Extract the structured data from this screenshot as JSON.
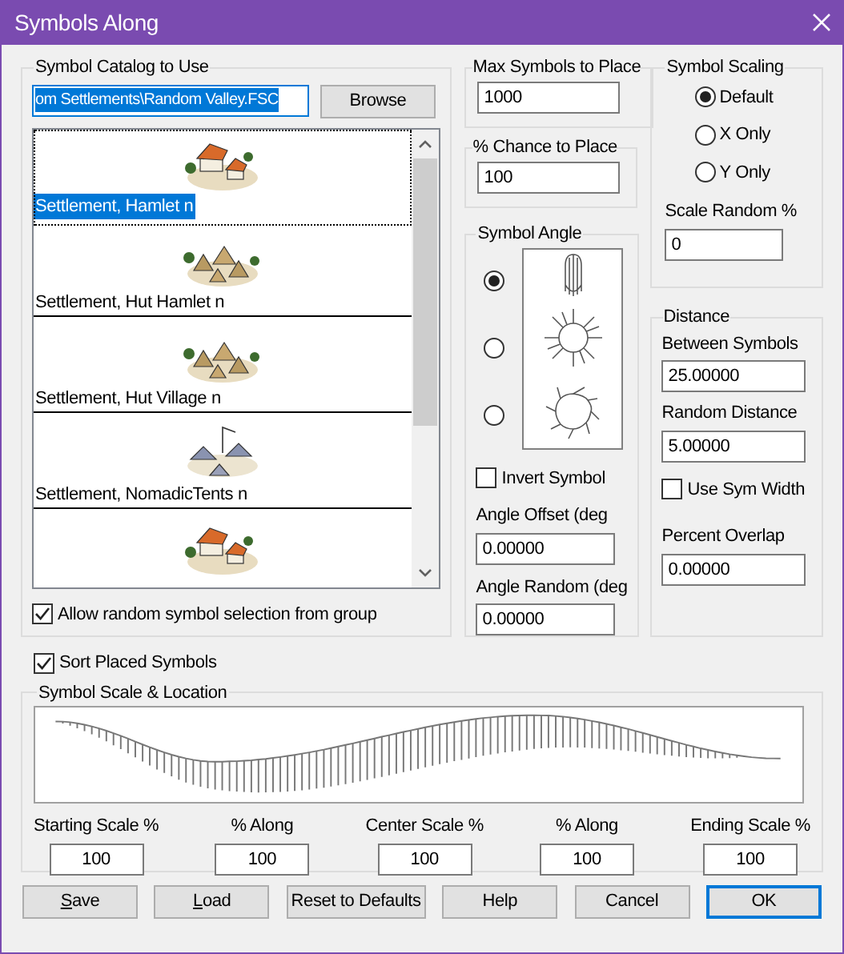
{
  "window": {
    "title": "Symbols Along"
  },
  "catalog": {
    "legend": "Symbol Catalog to Use",
    "path": "om Settlements\\Random Valley.FSC",
    "browse": "Browse",
    "items": [
      {
        "kind": "hamlet",
        "label": "Settlement, Hamlet n",
        "selected": true
      },
      {
        "kind": "huts",
        "label": "Settlement, Hut Hamlet n",
        "selected": false
      },
      {
        "kind": "huts",
        "label": "Settlement, Hut Village n",
        "selected": false
      },
      {
        "kind": "tents",
        "label": "Settlement, NomadicTents n",
        "selected": false
      },
      {
        "kind": "hamlet",
        "selected": false
      }
    ],
    "allow_random": {
      "label": "Allow random symbol selection from group",
      "checked": true
    }
  },
  "max_symbols": {
    "legend": "Max Symbols to Place",
    "value": "1000"
  },
  "chance": {
    "legend": "% Chance to Place",
    "value": "100"
  },
  "symbol_angle": {
    "legend": "Symbol Angle",
    "options": [
      {
        "kind": "aligned",
        "selected": true
      },
      {
        "kind": "radial",
        "selected": false
      },
      {
        "kind": "spiral",
        "selected": false
      }
    ],
    "invert": {
      "label": "Invert Symbol",
      "checked": false
    },
    "angle_offset": {
      "label": "Angle Offset (deg",
      "value": "0.00000"
    },
    "angle_random": {
      "label": "Angle Random (deg",
      "value": "0.00000"
    }
  },
  "symbol_scaling": {
    "legend": "Symbol Scaling",
    "options": [
      {
        "label": "Default",
        "selected": true
      },
      {
        "label": "X Only",
        "selected": false
      },
      {
        "label": "Y Only",
        "selected": false
      }
    ],
    "scale_random": {
      "label": "Scale Random %",
      "value": "0"
    }
  },
  "distance": {
    "legend": "Distance",
    "between": {
      "label": "Between Symbols",
      "value": "25.00000"
    },
    "random": {
      "label": "Random Distance",
      "value": "5.00000"
    },
    "use_sym_width": {
      "label": "Use Sym Width",
      "checked": false
    },
    "overlap": {
      "label": "Percent Overlap",
      "value": "0.00000"
    }
  },
  "sort_placed": {
    "label": "Sort Placed Symbols",
    "checked": true
  },
  "scale_location": {
    "legend": "Symbol Scale & Location",
    "fields": [
      {
        "label": "Starting Scale %",
        "value": "100"
      },
      {
        "label": "% Along",
        "value": "100"
      },
      {
        "label": "Center Scale %",
        "value": "100"
      },
      {
        "label": "% Along",
        "value": "100"
      },
      {
        "label": "Ending Scale %",
        "value": "100"
      }
    ]
  },
  "buttons": [
    {
      "label": "Save",
      "mnemonic": true,
      "default": false
    },
    {
      "label": "Load",
      "mnemonic": true,
      "default": false
    },
    {
      "label": "Reset to Defaults",
      "mnemonic": false,
      "default": false
    },
    {
      "label": "Help",
      "mnemonic": false,
      "default": false
    },
    {
      "label": "Cancel",
      "mnemonic": false,
      "default": false
    },
    {
      "label": "OK",
      "mnemonic": false,
      "default": true
    }
  ]
}
